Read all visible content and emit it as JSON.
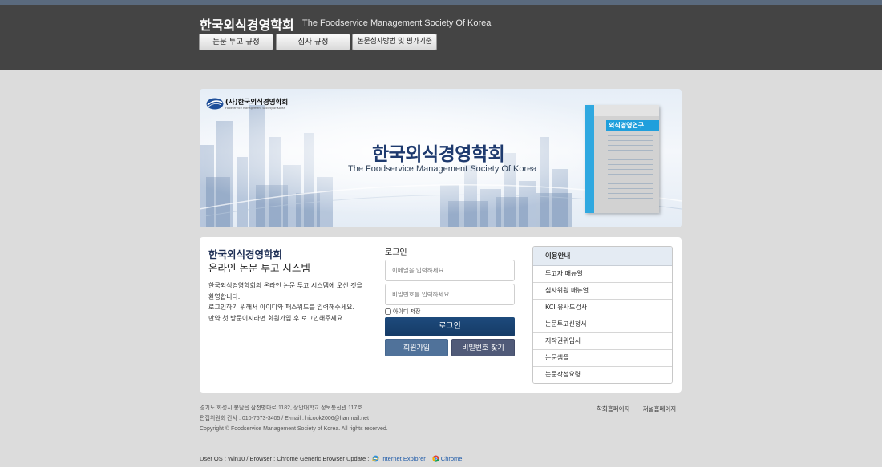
{
  "header": {
    "title": "한국외식경영학회",
    "subtitle": "The Foodservice Management Society Of Korea",
    "buttons": [
      "논문 투고 규정",
      "심사 규정",
      "논문심사방법 및 평가기준"
    ]
  },
  "banner": {
    "logo_text": "(사)한국외식경영학회",
    "logo_sub": "Foodservice Management Society of Korea",
    "title": "한국외식경영학회",
    "subtitle": "The Foodservice Management Society Of Korea",
    "journal_title": "외식경영연구"
  },
  "intro": {
    "title": "한국외식경영학회",
    "subtitle": "온라인 논문 투고 시스템",
    "lines": [
      "한국외식경영학회의 온라인 논문 투고 시스템에 오신 것을",
      "환영합니다.",
      "로그인하기 위해서 아이디와 패스워드를 입력해주세요.",
      "만약 첫 방문이시라면 회원가입 후 로그인해주세요."
    ]
  },
  "login": {
    "heading": "로그인",
    "email_placeholder": "이메일을 입력하세요",
    "password_placeholder": "비밀번호를 입력하세요",
    "remember_label": "아이디 저장",
    "login_button": "로그인",
    "join_button": "회원가입",
    "find_button": "비밀번호 찾기"
  },
  "guide": {
    "heading": "이용안내",
    "items": [
      "투고자 매뉴얼",
      "심사위원 매뉴얼",
      "KCI 유사도검사",
      "논문투고신청서",
      "저작권위임서",
      "논문샘플",
      "논문작성요령"
    ]
  },
  "footer": {
    "address": "경기도 화성시 봉담읍 삼천병마로 1182, 장안대학교 정보통신관 117호",
    "contact": "편집위원회 간사 : 010-7673-3405 / E-mail : hicook2006@hanmail.net",
    "copyright": "Copyright © Foodservice Management Society of Korea. All rights reserved.",
    "links": [
      "학회홈페이지",
      "저널홈페이지"
    ],
    "browser_text": "User OS : Win10 / Browser : Chrome Generic Browser Update :",
    "browsers": [
      "Internet Explorer",
      "Chrome"
    ]
  },
  "colors": {
    "header_bg": "#444444",
    "navy": "#1e3a6e",
    "login_button": "#153b66",
    "join_button": "#50729a",
    "find_button": "#505a78",
    "journal_blue": "#1f9fdc"
  }
}
